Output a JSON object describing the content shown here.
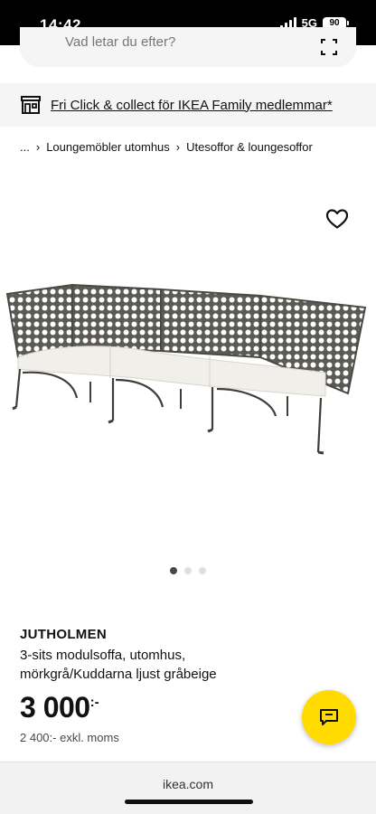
{
  "status_bar": {
    "time": "14:42",
    "network": "5G",
    "battery": "90"
  },
  "search": {
    "placeholder": "Vad letar du efter?"
  },
  "promo": {
    "text": "Fri Click & collect för IKEA Family medlemmar*"
  },
  "breadcrumb": {
    "ellipsis": "...",
    "items": [
      "Loungemöbler utomhus",
      "Utesoffor & loungesoffor"
    ]
  },
  "carousel": {
    "total": 3,
    "active_index": 1
  },
  "product": {
    "name": "JUTHOLMEN",
    "description": "3-sits modulsoffa, utomhus, mörkgrå/Kuddarna ljust gråbeige",
    "price": "3 000",
    "price_suffix": ":-",
    "price_excl_vat": "2 400:- exkl. moms"
  },
  "browser": {
    "url": "ikea.com"
  },
  "colors": {
    "chat_button": "#ffdb00",
    "sofa_frame": "#5b5a54",
    "cushion": "#f1efea"
  }
}
